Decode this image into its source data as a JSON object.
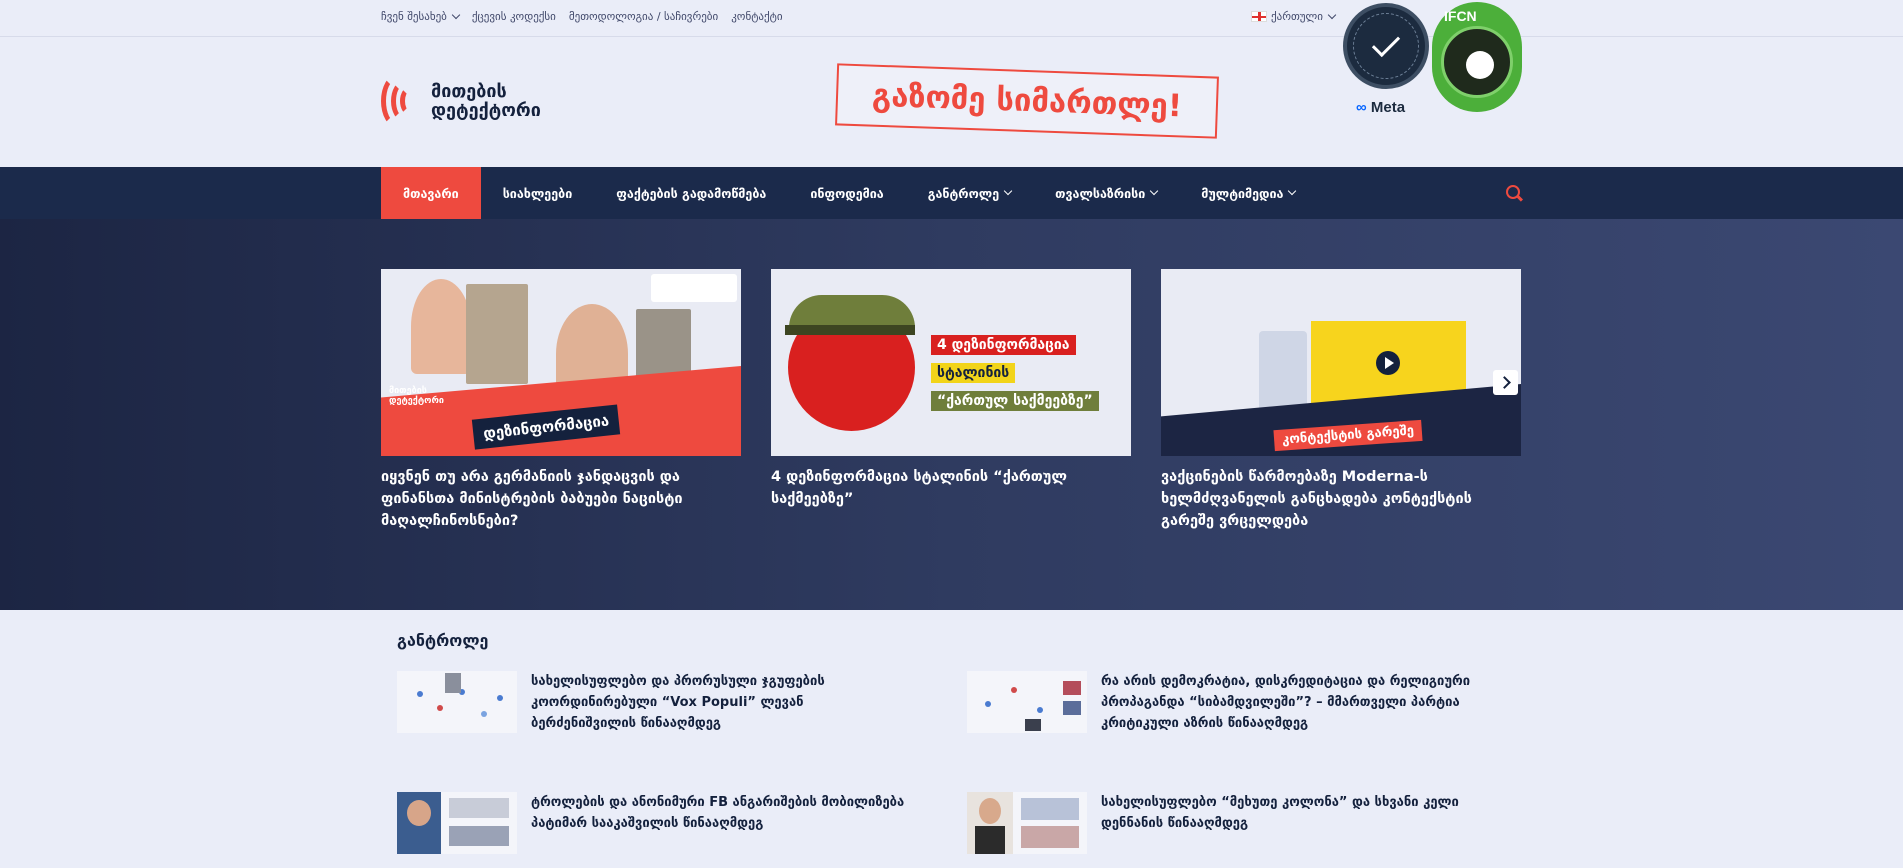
{
  "topbar": {
    "links": [
      {
        "label": "ჩვენ შესახებ",
        "dropdown": true
      },
      {
        "label": "ქცევის კოდექსი",
        "dropdown": false
      },
      {
        "label": "მეთოდოლოგია / საჩივრები",
        "dropdown": false
      },
      {
        "label": "კონტაქტი",
        "dropdown": false
      }
    ],
    "language": "ქართული"
  },
  "badges": {
    "meta_label": "Meta",
    "ifcn_label": "IFCN"
  },
  "header": {
    "logo_line1": "მითების",
    "logo_line2": "დეტექტორი",
    "slogan": "გაზომე სიმართლე!"
  },
  "nav": {
    "items": [
      {
        "label": "მთავარი",
        "active": true,
        "dropdown": false
      },
      {
        "label": "სიახლეები",
        "active": false,
        "dropdown": false
      },
      {
        "label": "ფაქტების გადამოწმება",
        "active": false,
        "dropdown": false
      },
      {
        "label": "ინფოდემია",
        "active": false,
        "dropdown": false
      },
      {
        "label": "განტროლე",
        "active": false,
        "dropdown": true
      },
      {
        "label": "თვალსაზრისი",
        "active": false,
        "dropdown": true
      },
      {
        "label": "მულტიმედია",
        "active": false,
        "dropdown": true
      }
    ],
    "search_icon": "search-icon"
  },
  "featured": [
    {
      "title": "იყვნენ თუ არა გერმანიის ჯანდაცვის და ფინანსთა მინისტრების ბაბუები ნაცისტი მაღალჩინოსნები?",
      "tag": "დეზინფორმაცია",
      "logo_line1": "მითების",
      "logo_line2": "დეტექტორი"
    },
    {
      "title": "4 დეზინფორმაცია სტალინის “ქართულ საქმეებზე”",
      "bar1": "4 დეზინფორმაცია",
      "bar2": "სტალინის",
      "bar3": "“ქართულ საქმეებზე”"
    },
    {
      "title": "ვაქცინების წარმოებაზე Moderna-ს ხელმძღვანელის განცხადება კონტექსტის გარეშე ვრცელდება",
      "tag": "კონტექსტის გარეშე"
    }
  ],
  "section": {
    "title": "განტროლე",
    "posts": [
      {
        "title": "სახელისუფლებო და პრორუსული ჯგუფების კოორდინირებული “Vox Populi” ლევან ბერძენიშვილის წინააღმდეგ"
      },
      {
        "title": "რა არის დემოკრატია, დისკრედიტაცია და რელიგიური პროპაგანდა “სიბამდვილეში”? – მმართველი პარტია კრიტიკული აზრის წინააღმდეგ"
      },
      {
        "title": "ტროლების და ანონიმური FB ანგარიშების მობილიზება პატიმარ სააკაშვილის წინააღმდეგ"
      },
      {
        "title": "სახელისუფლებო “მეხუთე კოლონა” და სხვანი კელი დენნანის წინააღმდეგ"
      }
    ]
  },
  "colors": {
    "accent": "#ee4a3f",
    "navy": "#1b2a4b",
    "background": "#eaedf8"
  }
}
